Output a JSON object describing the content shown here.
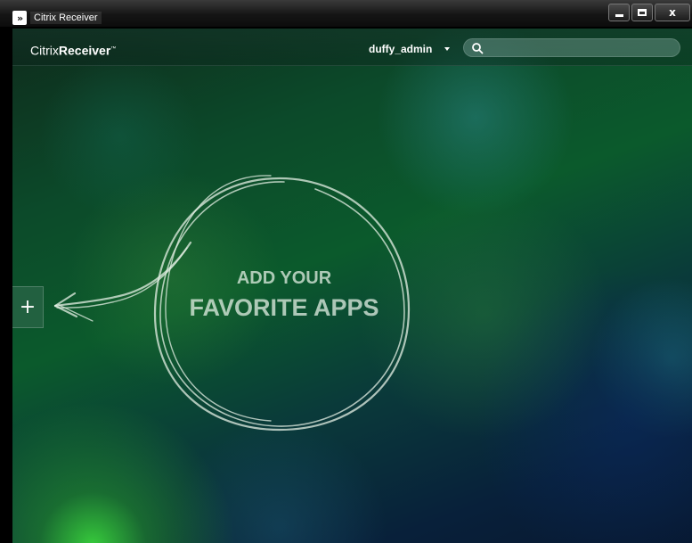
{
  "window": {
    "title": "Citrix Receiver",
    "app_icon": "citrix-receiver-icon",
    "controls": [
      {
        "name": "minimize",
        "icon": "minimize-icon"
      },
      {
        "name": "maximize",
        "icon": "maximize-icon"
      },
      {
        "name": "close",
        "label": "x",
        "icon": "close-icon"
      }
    ]
  },
  "header": {
    "brand_citrix": "Citrix",
    "brand_receiver": "Receiver",
    "brand_tm": "™",
    "username": "duffy_admin",
    "search_placeholder": ""
  },
  "sidebar": {
    "add_label": "+"
  },
  "main": {
    "cta_line1": "ADD YOUR",
    "cta_line2": "FAVORITE APPS"
  },
  "colors": {
    "background_dark": "#0b3a2a",
    "background_green": "#0b5a2c",
    "accent_text": "#ffffff"
  }
}
